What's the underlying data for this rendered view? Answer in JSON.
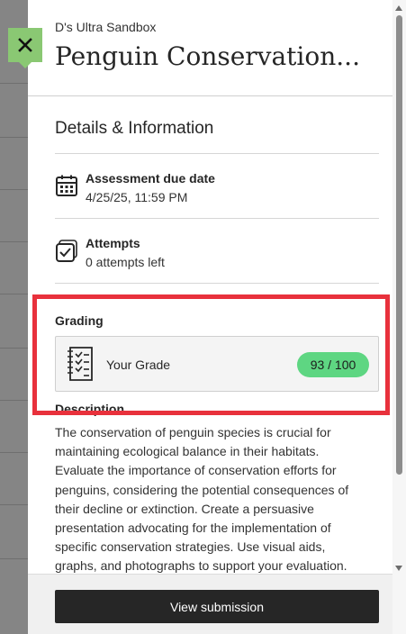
{
  "panel": {
    "course_name": "D's Ultra Sandbox",
    "title": "Penguin Conservation..."
  },
  "details": {
    "heading": "Details & Information",
    "due": {
      "label": "Assessment due date",
      "value": "4/25/25, 11:59 PM",
      "icon": "calendar-icon"
    },
    "attempts": {
      "label": "Attempts",
      "value": "0 attempts left",
      "icon": "attempts-icon"
    }
  },
  "grading": {
    "heading": "Grading",
    "your_grade_label": "Your Grade",
    "grade_value": "93 / 100",
    "icon": "rubric-checklist-icon",
    "pill_color": "#5ed682"
  },
  "description": {
    "heading": "Description",
    "text": "The conservation of penguin species is crucial for maintaining ecological balance in their habitats. Evaluate the importance of conservation efforts for penguins, considering the potential consequences of their decline or extinction. Create a persuasive presentation advocating for the implementation of specific conservation strategies. Use visual aids, graphs, and photographs to support your evaluation."
  },
  "footer": {
    "view_submission_label": "View submission"
  },
  "colors": {
    "close_button": "#8ac873",
    "highlight_border": "#e8313c",
    "primary_button": "#262626"
  }
}
